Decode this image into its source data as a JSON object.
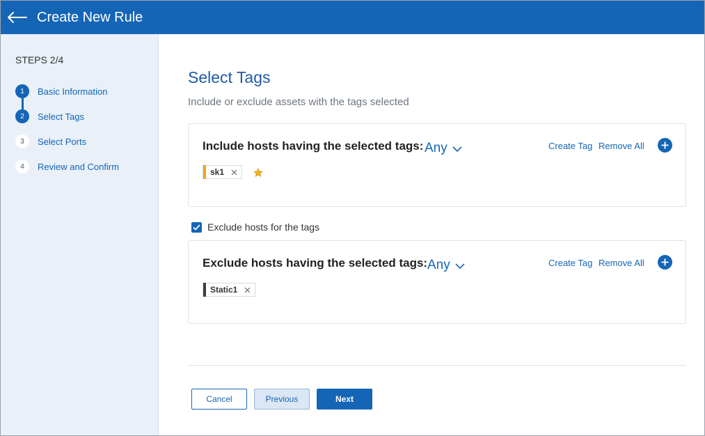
{
  "header": {
    "title": "Create New Rule",
    "back_icon": "arrow-left-icon"
  },
  "sidebar": {
    "steps_title": "STEPS 2/4",
    "steps": [
      {
        "number": "1",
        "label": "Basic Information",
        "state": "done"
      },
      {
        "number": "2",
        "label": "Select Tags",
        "state": "current"
      },
      {
        "number": "3",
        "label": "Select Ports",
        "state": "todo"
      },
      {
        "number": "4",
        "label": "Review and Confirm",
        "state": "todo"
      }
    ]
  },
  "main": {
    "title": "Select Tags",
    "subtitle": "Include or exclude assets with the tags selected",
    "include": {
      "heading": "Include hosts having the selected tags:",
      "match": "Any",
      "create_tag": "Create Tag",
      "remove_all": "Remove All",
      "tags": [
        {
          "label": "sk1",
          "color": "#f0a41c",
          "starred": true
        }
      ]
    },
    "exclude_toggle": {
      "label": "Exclude hosts for the tags",
      "checked": true
    },
    "exclude": {
      "heading": "Exclude hosts having the selected tags:",
      "match": "Any",
      "create_tag": "Create Tag",
      "remove_all": "Remove All",
      "tags": [
        {
          "label": "Static1",
          "color": "#3a3f45",
          "starred": false
        }
      ]
    }
  },
  "footer": {
    "cancel": "Cancel",
    "previous": "Previous",
    "next": "Next"
  },
  "colors": {
    "primary": "#1565b6",
    "sidebar_bg": "#e9f0f8",
    "star": "#f0a41c"
  }
}
